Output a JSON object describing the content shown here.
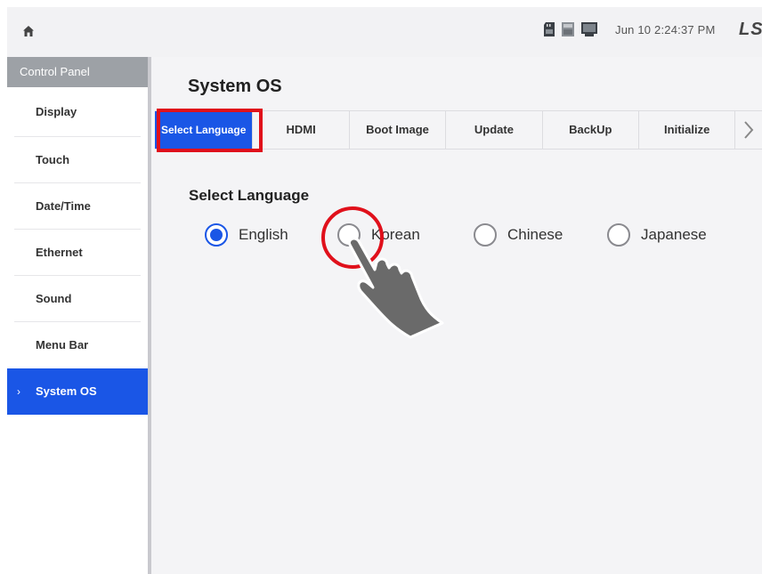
{
  "topbar": {
    "home_icon": "home-icon",
    "status_icons": [
      "sd-card-icon",
      "usb-icon",
      "monitor-icon"
    ],
    "clock": "Jun 10 2:24:37 PM",
    "brand": "LS"
  },
  "sidebar": {
    "header": "Control Panel",
    "items": [
      {
        "label": "Display"
      },
      {
        "label": "Touch"
      },
      {
        "label": "Date/Time"
      },
      {
        "label": "Ethernet"
      },
      {
        "label": "Sound"
      },
      {
        "label": "Menu Bar"
      },
      {
        "label": "System OS",
        "active": true,
        "marker": "›"
      }
    ]
  },
  "main": {
    "title": "System OS",
    "tabs": [
      {
        "label": "Select Language",
        "active": true
      },
      {
        "label": "HDMI"
      },
      {
        "label": "Boot Image"
      },
      {
        "label": "Update"
      },
      {
        "label": "BackUp"
      },
      {
        "label": "Initialize"
      }
    ],
    "tabs_more_icon": "chevron-right-icon",
    "section_title": "Select Language",
    "language_options": [
      {
        "label": "English",
        "selected": true
      },
      {
        "label": "Korean",
        "selected": false
      },
      {
        "label": "Chinese",
        "selected": false
      },
      {
        "label": "Japanese",
        "selected": false
      }
    ]
  },
  "annotations": {
    "highlighted_tab": "Select Language",
    "tap_target": "Korean",
    "pointer_icon": "hand-pointer-icon"
  },
  "colors": {
    "accent": "#1a56e6",
    "highlight": "#e0101b",
    "sidebar_header": "#9da1a6"
  }
}
